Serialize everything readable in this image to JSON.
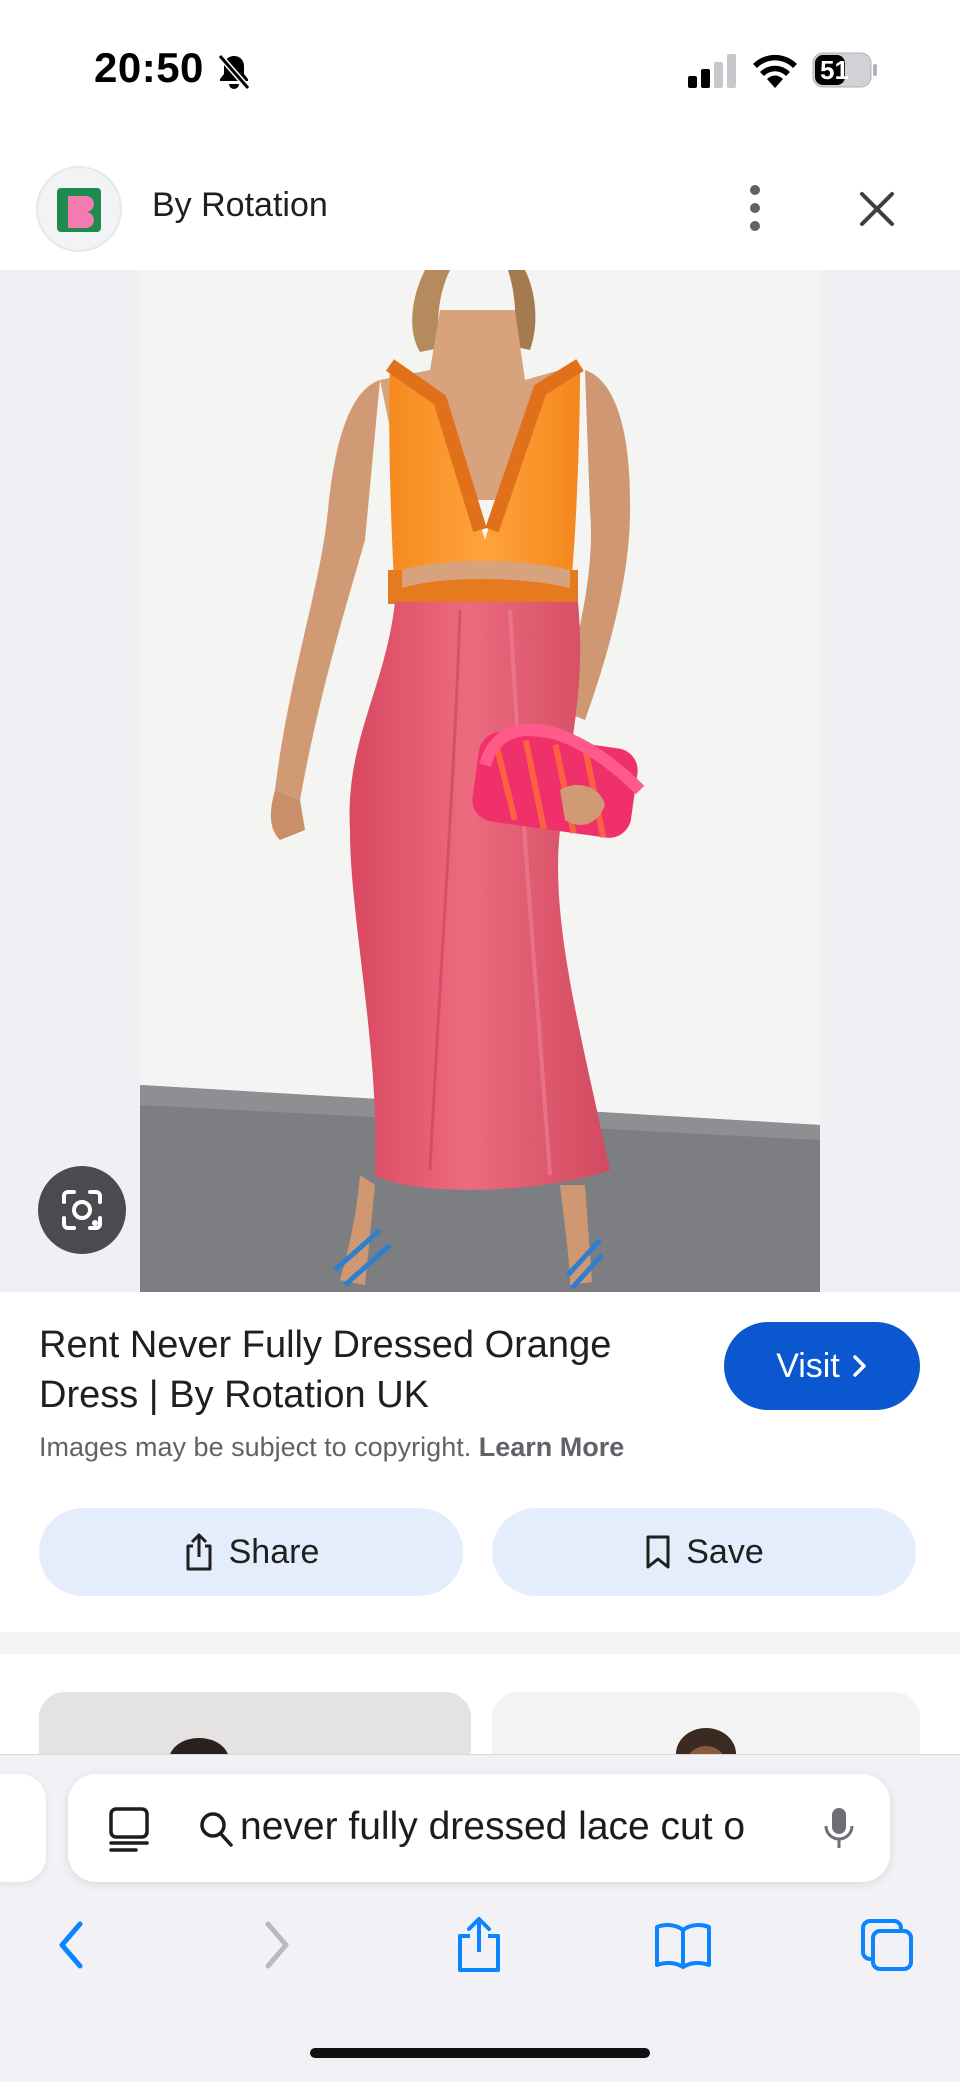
{
  "status_bar": {
    "time": "20:50",
    "battery_level": "51"
  },
  "header": {
    "site_name": "By Rotation"
  },
  "result": {
    "title": "Rent Never Fully Dressed Orange Dress | By Rotation UK",
    "visit_label": "Visit",
    "copyright_text": "Images may be subject to copyright.",
    "learn_more_label": "Learn More",
    "share_label": "Share",
    "save_label": "Save"
  },
  "browser": {
    "address_text": "never fully dressed lace cut o"
  },
  "colors": {
    "accent": "#0b57d0",
    "pill_bg": "#e3edfb",
    "safari_blue": "#0a84ff",
    "top_orange": "#f7902a",
    "skirt_pink": "#e85c72",
    "clutch_pink": "#f0306a"
  },
  "icons": {
    "status": [
      "bell-slash-icon",
      "signal-icon",
      "wifi-icon",
      "battery-icon"
    ],
    "header": [
      "site-logo",
      "more-vert-icon",
      "close-icon"
    ],
    "image": [
      "lens-icon"
    ],
    "actions": [
      "chevron-right-icon",
      "share-icon",
      "bookmark-icon"
    ],
    "toolbar": [
      "reader-icon",
      "search-icon",
      "mic-icon",
      "back-icon",
      "forward-icon",
      "share-icon",
      "bookmarks-icon",
      "tabs-icon"
    ]
  }
}
